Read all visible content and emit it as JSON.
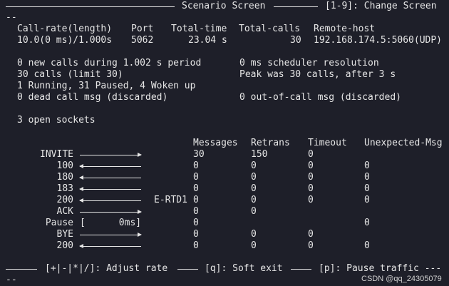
{
  "header": {
    "title": "Scenario Screen",
    "change_hint": "[1-9]: Change Screen",
    "dashes": "--"
  },
  "stats": {
    "headers": [
      "Call-rate(length)",
      "Port",
      "Total-time",
      "Total-calls",
      "Remote-host"
    ],
    "values": [
      "10.0(0 ms)/1.000s",
      "5062",
      "23.04 s",
      "30",
      "192.168.174.5:5060(UDP)"
    ]
  },
  "status": {
    "line1_left": "0 new calls during 1.002 s period",
    "line1_right": "0 ms scheduler resolution",
    "line2_left": "30 calls (limit 30)",
    "line2_right": "Peak was 30 calls, after 3 s",
    "line3": "1 Running, 31 Paused, 4 Woken up",
    "line4_left": "0 dead call msg (discarded)",
    "line4_right": "0 out-of-call msg (discarded)",
    "sockets": "3 open sockets"
  },
  "table": {
    "headers": [
      "Messages",
      "Retrans",
      "Timeout",
      "Unexpected-Msg"
    ],
    "rows": [
      {
        "label": "INVITE",
        "dir": "right",
        "messages": "30",
        "retrans": "150",
        "timeout": "0",
        "unexpected": ""
      },
      {
        "label": "100",
        "dir": "left",
        "messages": "0",
        "retrans": "0",
        "timeout": "0",
        "unexpected": "0"
      },
      {
        "label": "180",
        "dir": "left",
        "messages": "0",
        "retrans": "0",
        "timeout": "0",
        "unexpected": "0"
      },
      {
        "label": "183",
        "dir": "left",
        "messages": "0",
        "retrans": "0",
        "timeout": "0",
        "unexpected": "0"
      },
      {
        "label": "200",
        "dir": "left",
        "rtd": "E-RTD1",
        "messages": "0",
        "retrans": "0",
        "timeout": "0",
        "unexpected": "0"
      },
      {
        "label": "ACK",
        "dir": "right",
        "messages": "0",
        "retrans": "0",
        "timeout": "",
        "unexpected": ""
      },
      {
        "label": "Pause",
        "pause": "[      0ms]",
        "messages": "0",
        "retrans": "",
        "timeout": "",
        "unexpected": "0"
      },
      {
        "label": "BYE",
        "dir": "right",
        "messages": "0",
        "retrans": "0",
        "timeout": "0",
        "unexpected": ""
      },
      {
        "label": "200",
        "dir": "left",
        "messages": "0",
        "retrans": "0",
        "timeout": "0",
        "unexpected": "0"
      }
    ]
  },
  "footer": {
    "adjust": "[+|-|*|/]: Adjust rate",
    "quit": "[q]: Soft exit",
    "pause": "[p]: Pause traffic ---",
    "dashes": "--"
  },
  "watermark": "CSDN @qq_24305079"
}
